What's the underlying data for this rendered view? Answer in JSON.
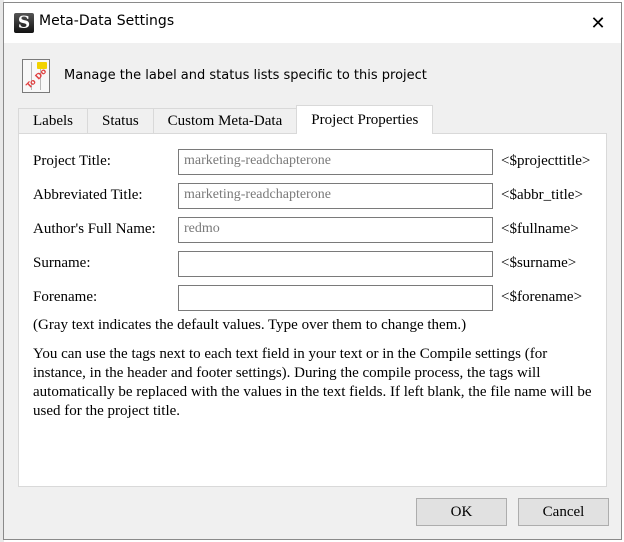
{
  "window": {
    "title": "Meta-Data Settings",
    "app_icon": "scrivener-icon",
    "close_icon": "close-icon",
    "close_glyph": "✕"
  },
  "header": {
    "icon": "todo-list-icon",
    "icon_stamp": "To Do",
    "text": "Manage the label and status lists specific to this project"
  },
  "tabs": [
    {
      "label": "Labels",
      "active": false
    },
    {
      "label": "Status",
      "active": false
    },
    {
      "label": "Custom Meta-Data",
      "active": false
    },
    {
      "label": "Project Properties",
      "active": true
    }
  ],
  "fields": [
    {
      "label": "Project Title:",
      "value": "marketing-readchapterone",
      "tag": "<$projecttitle>"
    },
    {
      "label": "Abbreviated Title:",
      "value": "marketing-readchapterone",
      "tag": "<$abbr_title>"
    },
    {
      "label": "Author's Full Name:",
      "value": "redmo",
      "tag": "<$fullname>"
    },
    {
      "label": "Surname:",
      "value": "",
      "tag": "<$surname>"
    },
    {
      "label": "Forename:",
      "value": "",
      "tag": "<$forename>"
    }
  ],
  "note": "(Gray text indicates the default values. Type over them to change them.)",
  "help_text": "You can use the tags next to each text field in your text or in the Compile settings (for instance, in the header and footer settings). During the compile process, the tags will automatically be replaced with the values in the text fields. If left blank, the file name will be used for the project title.",
  "buttons": {
    "ok": "OK",
    "cancel": "Cancel"
  }
}
